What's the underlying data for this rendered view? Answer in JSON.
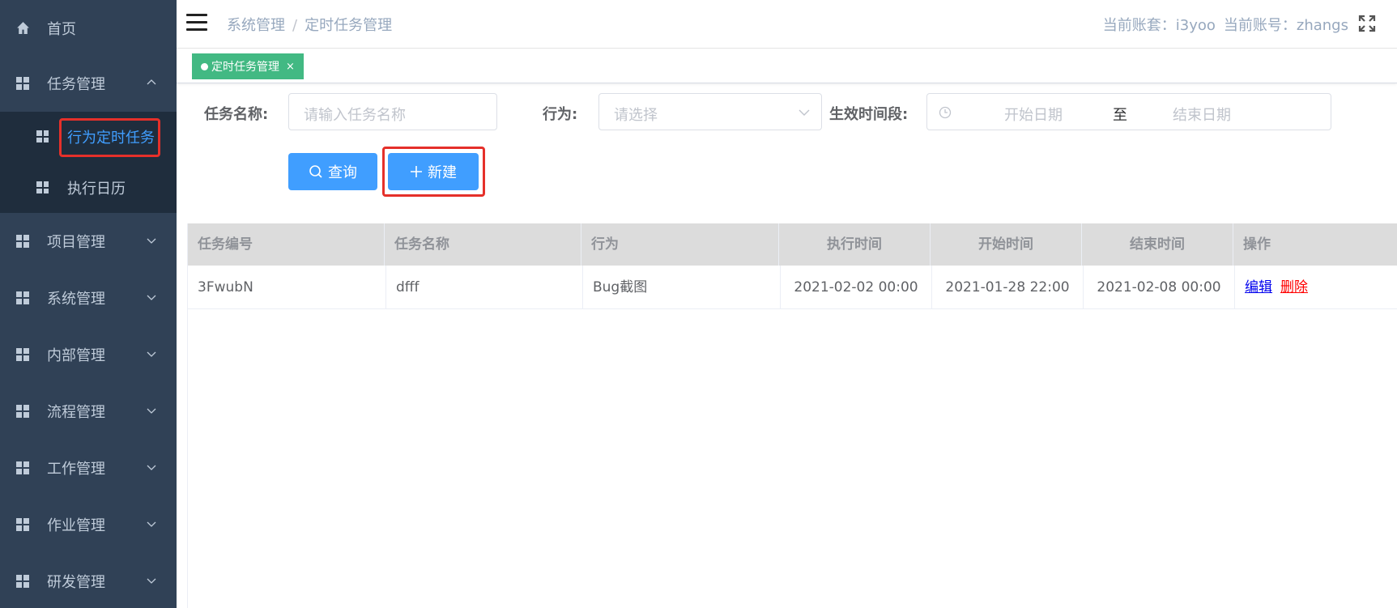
{
  "sidebar": {
    "items": [
      {
        "label": "首页",
        "icon": "home-icon"
      },
      {
        "label": "任务管理",
        "icon": "grid-icon",
        "expanded": true
      },
      {
        "label": "项目管理",
        "icon": "grid-icon"
      },
      {
        "label": "系统管理",
        "icon": "grid-icon"
      },
      {
        "label": "内部管理",
        "icon": "grid-icon"
      },
      {
        "label": "流程管理",
        "icon": "grid-icon"
      },
      {
        "label": "工作管理",
        "icon": "grid-icon"
      },
      {
        "label": "作业管理",
        "icon": "grid-icon"
      },
      {
        "label": "研发管理",
        "icon": "grid-icon"
      }
    ],
    "subitems": [
      {
        "label": "行为定时任务",
        "active": true
      },
      {
        "label": "执行日历",
        "active": false
      }
    ]
  },
  "header": {
    "breadcrumb": [
      "系统管理",
      "定时任务管理"
    ],
    "account_set": "当前账套：i3yoo",
    "account": "当前账号：zhangs"
  },
  "tags": [
    {
      "label": "定时任务管理",
      "close": "×"
    }
  ],
  "filters": {
    "task_name_label": "任务名称:",
    "task_name_placeholder": "请输入任务名称",
    "behavior_label": "行为:",
    "behavior_placeholder": "请选择",
    "period_label": "生效时间段:",
    "start_placeholder": "开始日期",
    "range_sep": "至",
    "end_placeholder": "结束日期"
  },
  "buttons": {
    "query": "查询",
    "create": "新建"
  },
  "table": {
    "columns": [
      "任务编号",
      "任务名称",
      "行为",
      "执行时间",
      "开始时间",
      "结束时间",
      "操作"
    ],
    "rows": [
      {
        "id": "3FwubN",
        "name": "dfff",
        "behavior": "Bug截图",
        "exec_time": "2021-02-02 00:00",
        "start_time": "2021-01-28 22:00",
        "end_time": "2021-02-08 00:00",
        "edit": "编辑",
        "delete": "删除"
      }
    ]
  },
  "colors": {
    "sidebar_bg": "#304156",
    "submenu_bg": "#1f2d3d",
    "accent": "#409eff",
    "tag": "#42b983",
    "highlight": "#e5302a"
  }
}
